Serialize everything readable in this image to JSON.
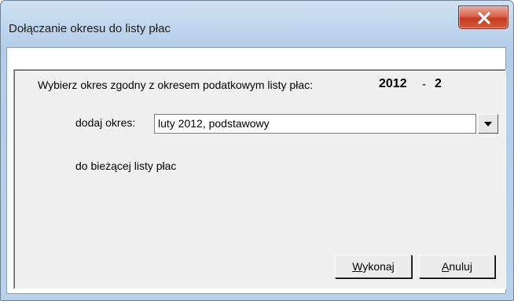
{
  "window": {
    "title": "Dołączanie okresu do listy płac"
  },
  "close_icon": "close-x-icon",
  "form": {
    "instruction": "Wybierz okres zgodny z okresem podatkowym listy płac:",
    "period_year": "2012",
    "period_separator": "-",
    "period_month": "2",
    "add_label": "dodaj okres:",
    "selected_period": "luty 2012, podstawowy",
    "target_label": "do bieżącej listy płac"
  },
  "buttons": {
    "run_mnemonic": "W",
    "run_rest": "ykonaj",
    "cancel_mnemonic": "A",
    "cancel_rest": "nuluj"
  },
  "colors": {
    "close_button": "#c9432a",
    "titlebar": "#bcd4ec",
    "panel": "#f0f0f0"
  }
}
